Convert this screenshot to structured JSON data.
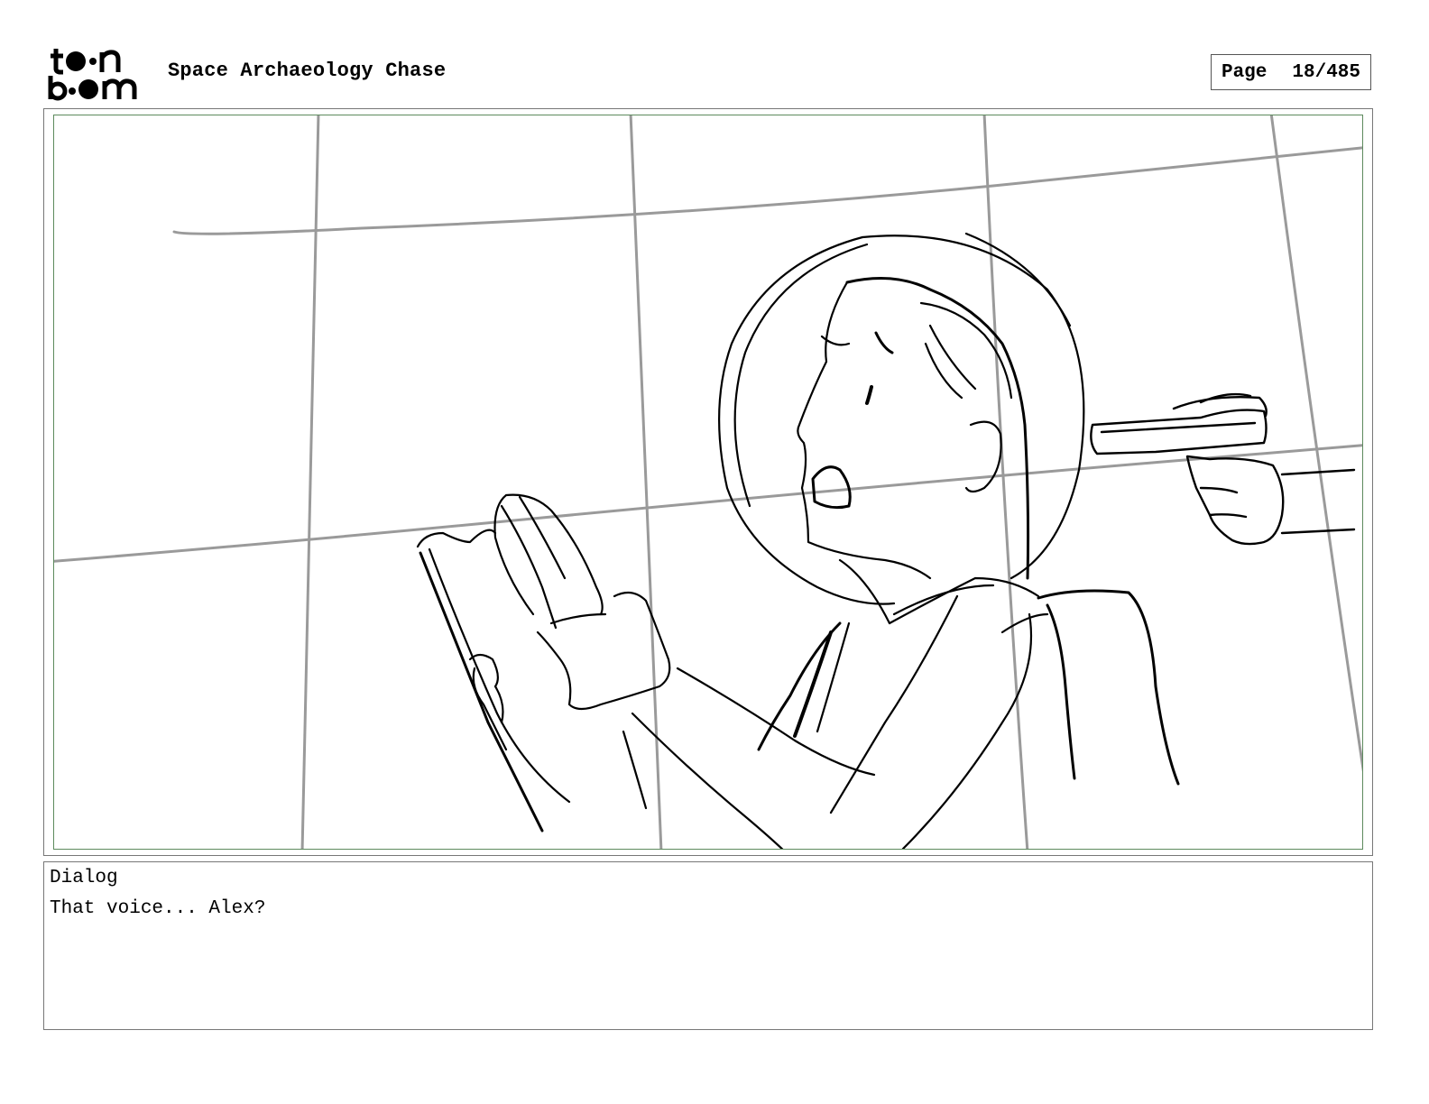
{
  "header": {
    "logo_line1": "toon",
    "logo_line2": "boom",
    "project_title": "Space Archaeology Chase",
    "page_label": "Page",
    "page_number": "18/485"
  },
  "panel": {
    "sketch_description_icon": "storyboard-sketch"
  },
  "dialog": {
    "label": "Dialog",
    "text": "That voice... Alex?"
  }
}
